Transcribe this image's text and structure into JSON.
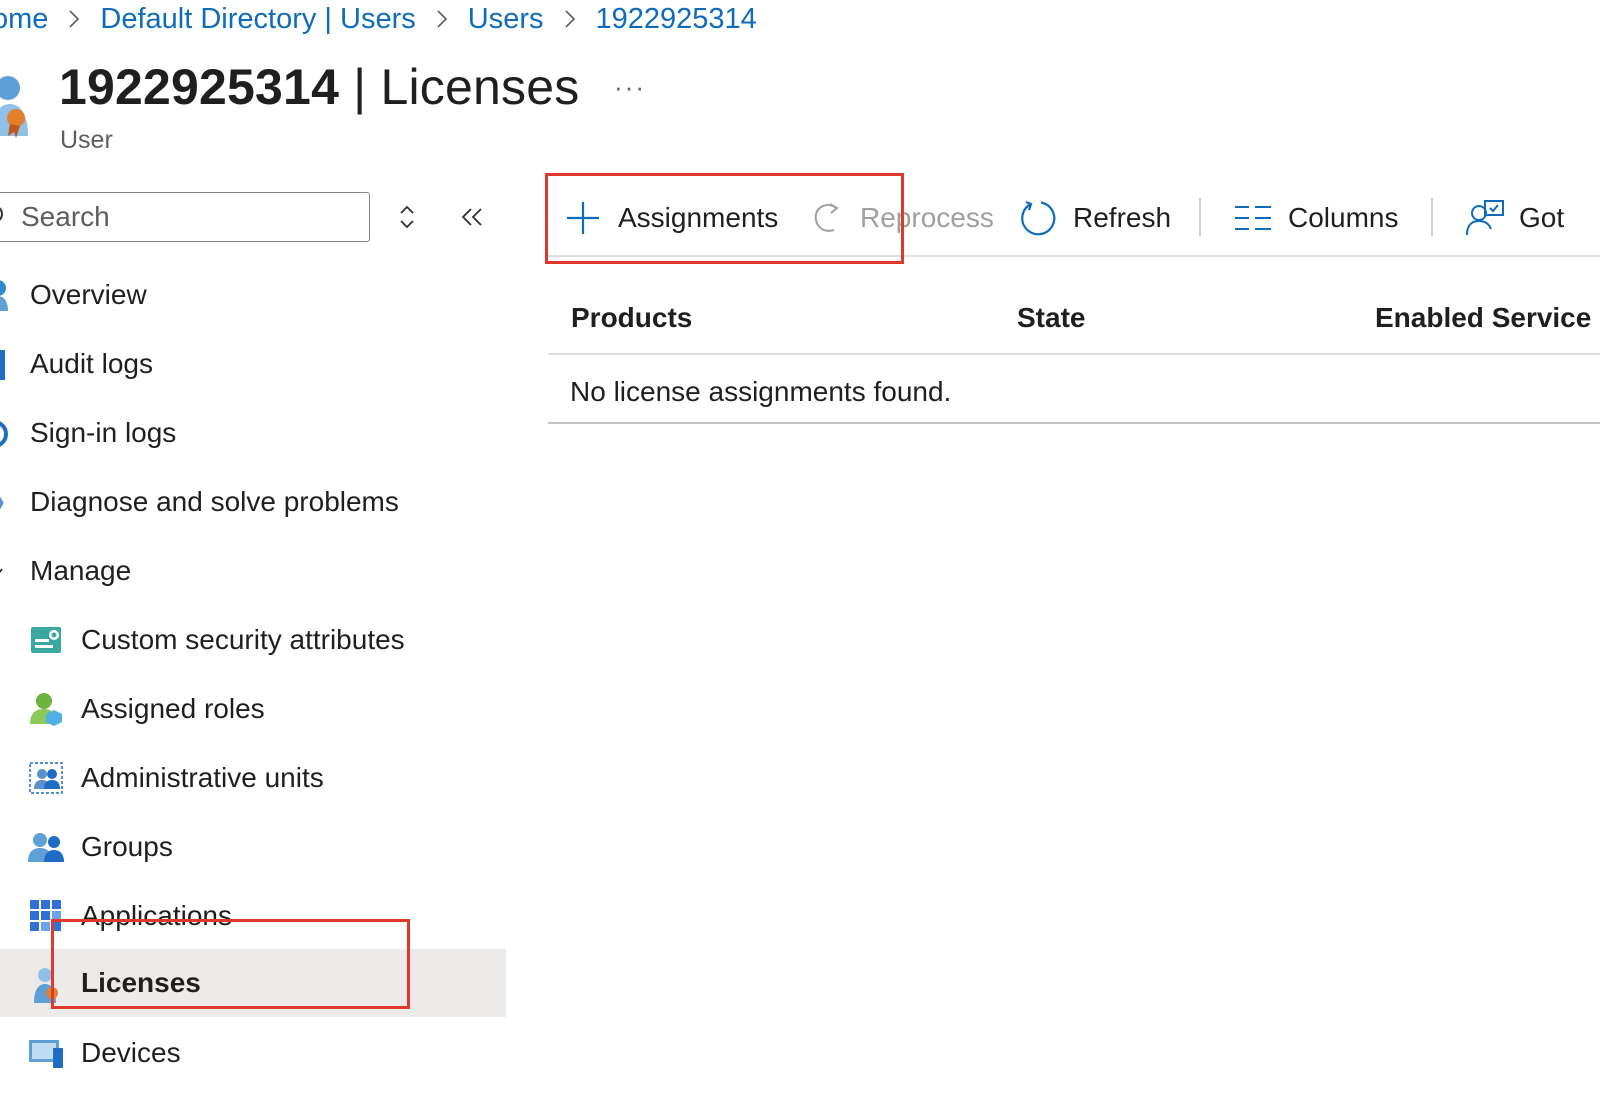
{
  "breadcrumb": {
    "items": [
      "ome",
      "Default Directory | Users",
      "Users",
      "1922925314"
    ]
  },
  "header": {
    "title_id": "1922925314",
    "title_sep": "|",
    "title_section": "Licenses",
    "subtitle": "User",
    "more_label": "···"
  },
  "search": {
    "placeholder": "Search"
  },
  "nav": {
    "overview": "Overview",
    "audit_logs": "Audit logs",
    "signin_logs": "Sign-in logs",
    "diagnose": "Diagnose and solve problems",
    "manage": "Manage",
    "custom_security": "Custom security attributes",
    "assigned_roles": "Assigned roles",
    "admin_units": "Administrative units",
    "groups": "Groups",
    "applications": "Applications",
    "licenses": "Licenses",
    "devices": "Devices"
  },
  "toolbar": {
    "assignments": "Assignments",
    "reprocess": "Reprocess",
    "refresh": "Refresh",
    "columns": "Columns",
    "got": "Got"
  },
  "table": {
    "columns": [
      "Products",
      "State",
      "Enabled Service"
    ],
    "empty_message": "No license assignments found."
  },
  "colors": {
    "accent": "#0f6cbd",
    "annotation": "#e0392b",
    "selected_bg": "#edebe9"
  }
}
